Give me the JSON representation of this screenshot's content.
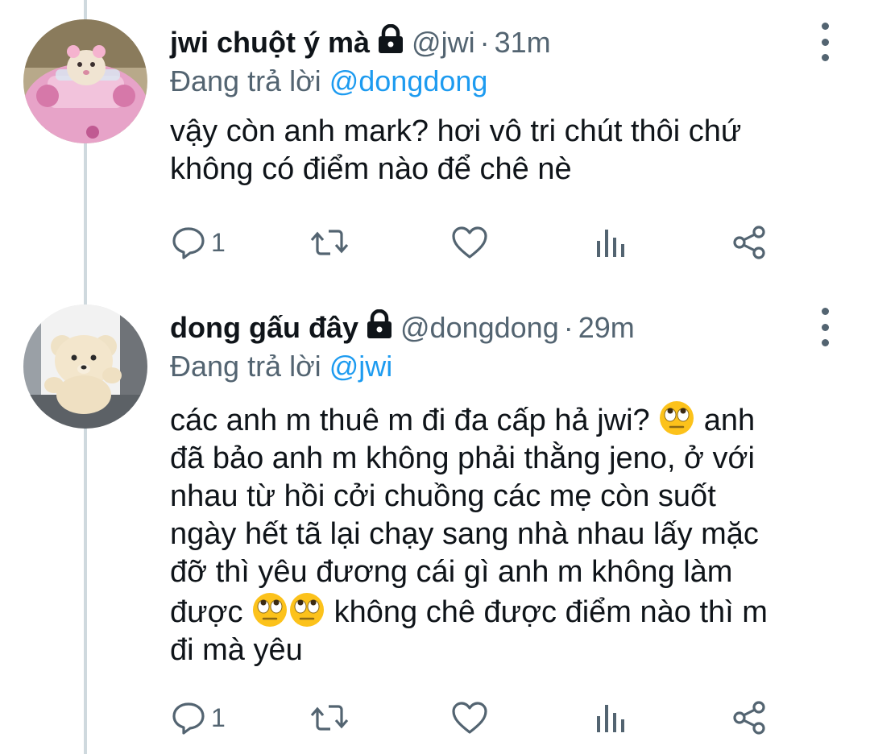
{
  "tweets": [
    {
      "name": "jwi chuột ý mà",
      "handle": "@jwi",
      "separator": "·",
      "time": "31m",
      "replying_prefix": "Đang trả lời",
      "replying_to": "@dongdong",
      "text": "vậy còn anh mark? hơi vô tri chút thôi chứ\nkhông có điểm nào để chê nè",
      "reply_count": "1",
      "avatar_icon": "avatar-pink-car",
      "lock_icon": "lock-icon"
    },
    {
      "name": "dong gấu đây",
      "handle": "@dongdong",
      "separator": "·",
      "time": "29m",
      "replying_prefix": "Đang trả lời",
      "replying_to": "@jwi",
      "text_parts": [
        "các anh m thuê m đi đa cấp hả jwi? ",
        " anh\nđã bảo anh m không phải thằng jeno, ở với\nnhau từ hồi cởi chuồng các mẹ còn suốt\nngày hết tã lại chạy sang nhà nhau lấy mặc\nđỡ thì yêu đương cái gì anh m không làm\nđược ",
        " không chê được điểm nào thì m\nđi mà yêu"
      ],
      "emoji_name": "face-with-rolling-eyes",
      "reply_count": "1",
      "avatar_icon": "avatar-teddy-bear",
      "lock_icon": "lock-icon"
    }
  ],
  "colors": {
    "text": "#0f1419",
    "secondary": "#536471",
    "link": "#1d9bf0",
    "thread_line": "#cfd9de"
  }
}
